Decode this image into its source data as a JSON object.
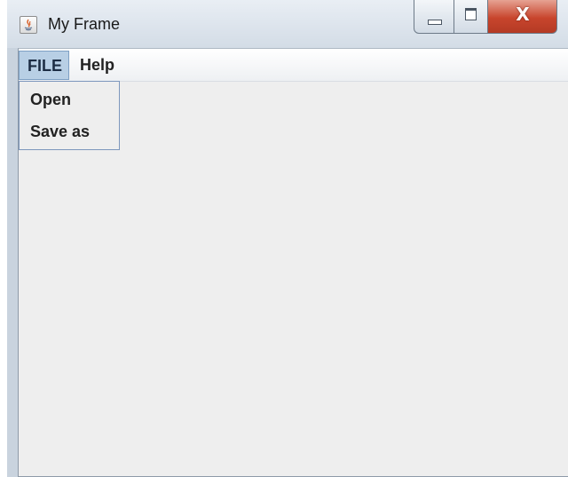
{
  "window": {
    "title": "My Frame",
    "icon": "java-icon",
    "controls": {
      "minimize_icon": "minimize-icon",
      "maximize_icon": "maximize-icon",
      "close_label": "X"
    }
  },
  "menubar": {
    "menus": [
      {
        "label": "FILE",
        "active": true
      },
      {
        "label": "Help",
        "active": false
      }
    ]
  },
  "dropdown": {
    "items": [
      {
        "label": "Open"
      },
      {
        "label": "Save as"
      }
    ]
  },
  "colors": {
    "menu_active_bg": "#b8cfe5",
    "client_bg": "#eeeeee",
    "close_button": "#c8452d"
  }
}
